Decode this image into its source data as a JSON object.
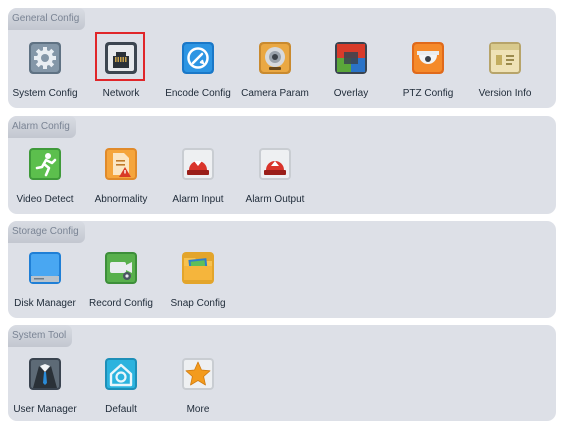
{
  "sections": [
    {
      "title": "General Config",
      "items": [
        {
          "label": "System Config",
          "icon": "gear-icon"
        },
        {
          "label": "Network",
          "icon": "ethernet-port-icon",
          "selected": true
        },
        {
          "label": "Encode Config",
          "icon": "encode-icon"
        },
        {
          "label": "Camera Param",
          "icon": "webcam-icon"
        },
        {
          "label": "Overlay",
          "icon": "overlay-icon"
        },
        {
          "label": "PTZ Config",
          "icon": "dome-camera-icon"
        },
        {
          "label": "Version Info",
          "icon": "version-info-icon"
        }
      ]
    },
    {
      "title": "Alarm Config",
      "items": [
        {
          "label": "Video Detect",
          "icon": "motion-detect-icon"
        },
        {
          "label": "Abnormality",
          "icon": "abnormality-document-icon"
        },
        {
          "label": "Alarm Input",
          "icon": "alarm-input-icon"
        },
        {
          "label": "Alarm Output",
          "icon": "alarm-output-icon"
        }
      ]
    },
    {
      "title": "Storage Config",
      "items": [
        {
          "label": "Disk Manager",
          "icon": "disk-icon"
        },
        {
          "label": "Record Config",
          "icon": "record-config-icon"
        },
        {
          "label": "Snap Config",
          "icon": "folder-icon"
        }
      ]
    },
    {
      "title": "System Tool",
      "items": [
        {
          "label": "User Manager",
          "icon": "user-icon"
        },
        {
          "label": "Default",
          "icon": "default-home-icon"
        },
        {
          "label": "More",
          "icon": "star-icon"
        }
      ]
    }
  ],
  "colors": {
    "section_bg": "#dde0e7",
    "selection_border": "#e0262a",
    "label_text": "#1e2a38",
    "tag_text": "#7a8494"
  }
}
